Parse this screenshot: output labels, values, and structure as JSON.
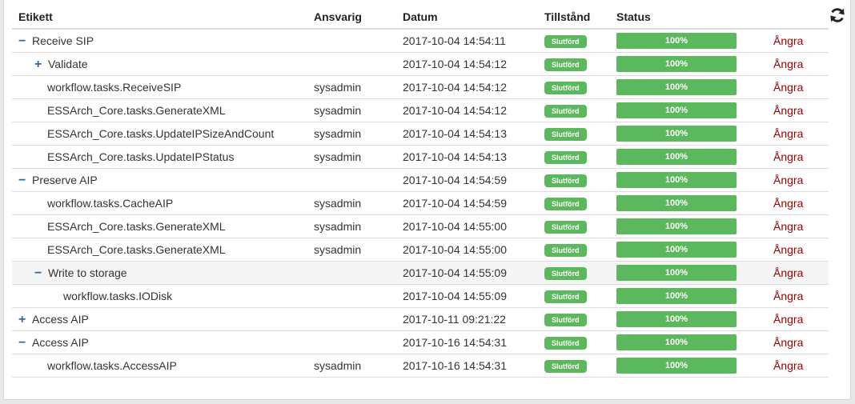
{
  "columns": {
    "label": "Etikett",
    "responsible": "Ansvarig",
    "date": "Datum",
    "state": "Tillstånd",
    "status": "Status"
  },
  "icons": {
    "refresh": "refresh-icon",
    "expand": "plus-icon",
    "collapse": "minus-icon"
  },
  "colors": {
    "success": "#5cb85c",
    "undo": "#a30000",
    "toggle": "#2a6aa8"
  },
  "rows": [
    {
      "toggle": "−",
      "label": "Receive SIP",
      "responsible": "",
      "date": "2017-10-04 14:54:11",
      "state": "Slutförd",
      "progress": "100%",
      "undo": "Ångra"
    },
    {
      "toggle": "+",
      "label": "Validate",
      "responsible": "",
      "date": "2017-10-04 14:54:12",
      "state": "Slutförd",
      "progress": "100%",
      "undo": "Ångra"
    },
    {
      "toggle": "",
      "label": "workflow.tasks.ReceiveSIP",
      "responsible": "sysadmin",
      "date": "2017-10-04 14:54:12",
      "state": "Slutförd",
      "progress": "100%",
      "undo": "Ångra"
    },
    {
      "toggle": "",
      "label": "ESSArch_Core.tasks.GenerateXML",
      "responsible": "sysadmin",
      "date": "2017-10-04 14:54:12",
      "state": "Slutförd",
      "progress": "100%",
      "undo": "Ångra"
    },
    {
      "toggle": "",
      "label": "ESSArch_Core.tasks.UpdateIPSizeAndCount",
      "responsible": "sysadmin",
      "date": "2017-10-04 14:54:13",
      "state": "Slutförd",
      "progress": "100%",
      "undo": "Ångra"
    },
    {
      "toggle": "",
      "label": "ESSArch_Core.tasks.UpdateIPStatus",
      "responsible": "sysadmin",
      "date": "2017-10-04 14:54:13",
      "state": "Slutförd",
      "progress": "100%",
      "undo": "Ångra"
    },
    {
      "toggle": "−",
      "label": "Preserve AIP",
      "responsible": "",
      "date": "2017-10-04 14:54:59",
      "state": "Slutförd",
      "progress": "100%",
      "undo": "Ångra"
    },
    {
      "toggle": "",
      "label": "workflow.tasks.CacheAIP",
      "responsible": "sysadmin",
      "date": "2017-10-04 14:54:59",
      "state": "Slutförd",
      "progress": "100%",
      "undo": "Ångra"
    },
    {
      "toggle": "",
      "label": "ESSArch_Core.tasks.GenerateXML",
      "responsible": "sysadmin",
      "date": "2017-10-04 14:55:00",
      "state": "Slutförd",
      "progress": "100%",
      "undo": "Ångra"
    },
    {
      "toggle": "",
      "label": "ESSArch_Core.tasks.GenerateXML",
      "responsible": "sysadmin",
      "date": "2017-10-04 14:55:00",
      "state": "Slutförd",
      "progress": "100%",
      "undo": "Ångra"
    },
    {
      "toggle": "−",
      "label": "Write to storage",
      "responsible": "",
      "date": "2017-10-04 14:55:09",
      "state": "Slutförd",
      "progress": "100%",
      "undo": "Ångra"
    },
    {
      "toggle": "",
      "label": "workflow.tasks.IODisk",
      "responsible": "",
      "date": "2017-10-04 14:55:09",
      "state": "Slutförd",
      "progress": "100%",
      "undo": "Ångra"
    },
    {
      "toggle": "+",
      "label": "Access AIP",
      "responsible": "",
      "date": "2017-10-11 09:21:22",
      "state": "Slutförd",
      "progress": "100%",
      "undo": "Ångra"
    },
    {
      "toggle": "−",
      "label": "Access AIP",
      "responsible": "",
      "date": "2017-10-16 14:54:31",
      "state": "Slutförd",
      "progress": "100%",
      "undo": "Ångra"
    },
    {
      "toggle": "",
      "label": "workflow.tasks.AccessAIP",
      "responsible": "sysadmin",
      "date": "2017-10-16 14:54:31",
      "state": "Slutförd",
      "progress": "100%",
      "undo": "Ångra"
    }
  ]
}
